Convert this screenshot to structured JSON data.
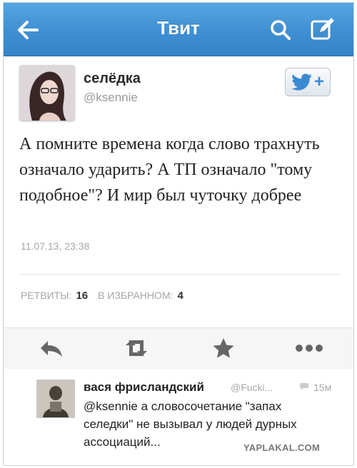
{
  "header": {
    "title": "Твит",
    "back_icon": "arrow-left-icon",
    "search_icon": "search-icon",
    "compose_icon": "compose-icon"
  },
  "tweet": {
    "author_name": "селёдка",
    "author_handle": "@ksennie",
    "follow_icon": "twitter-bird-plus-icon",
    "follow_plus": "+",
    "text": "А помните времена когда слово трахнуть означало ударить? А ТП означало \"тому подобное\"? И мир был чуточку добрее",
    "timestamp": "11.07.13, 23:38",
    "retweets_label": "РЕТВИТЫ:",
    "retweets_count": "16",
    "favorites_label": "В ИЗБРАННОМ:",
    "favorites_count": "4"
  },
  "actions": [
    {
      "name": "reply",
      "icon": "reply-arrow-icon"
    },
    {
      "name": "retweet",
      "icon": "retweet-icon"
    },
    {
      "name": "favorite",
      "icon": "star-icon"
    },
    {
      "name": "more",
      "icon": "more-dots-icon"
    }
  ],
  "reply": {
    "author_name": "вася фрисландский",
    "author_handle": "@Fucki...",
    "time": "15м",
    "text": "@ksennie а словосочетание \"запах селедки\" не вызывал у людей дурных ассоциаций..."
  },
  "watermark": "YAPLAKAL.COM",
  "colors": {
    "header_blue": "#3f8fd2",
    "twitter_blue": "#3a8ad2"
  }
}
